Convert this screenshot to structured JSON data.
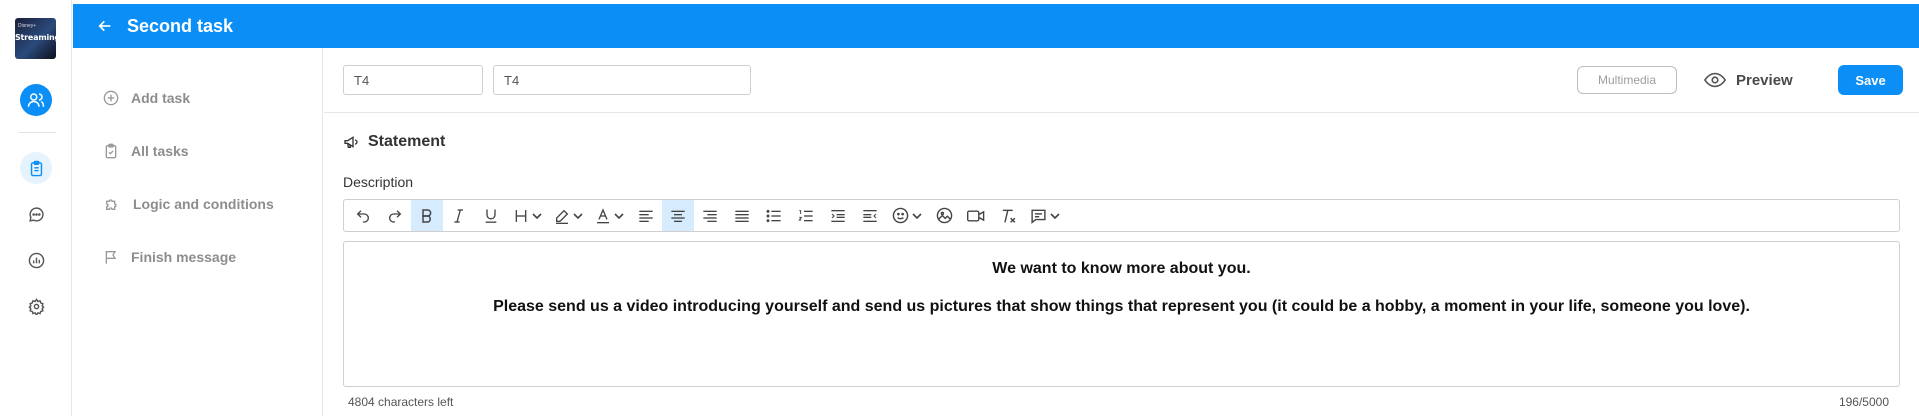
{
  "app": {
    "logo_text": "Streaming",
    "logo_sub": "Disney+"
  },
  "topbar": {
    "title": "Second task",
    "color": "#0b8ef6"
  },
  "rail": {
    "icons": [
      "users-icon",
      "clipboard-icon",
      "chat-icon",
      "chart-icon",
      "gear-icon"
    ]
  },
  "sidebar": {
    "items": [
      {
        "label": "Add task",
        "icon": "plus-circle-icon"
      },
      {
        "label": "All tasks",
        "icon": "clipboard-check-icon"
      },
      {
        "label": "Logic and conditions",
        "icon": "puzzle-icon"
      },
      {
        "label": "Finish message",
        "icon": "flag-icon"
      }
    ]
  },
  "header": {
    "code_value": "T4",
    "name_value": "T4",
    "multimedia_label": "Multimedia",
    "preview_label": "Preview",
    "save_label": "Save"
  },
  "statement": {
    "title": "Statement",
    "description_label": "Description",
    "line1": "We want to know more about you.",
    "line2": "Please send us a video introducing yourself and send us pictures that show things that represent you (it could be a hobby, a moment in your life, someone you love).",
    "chars_left": "4804 characters left",
    "char_count": "196/5000"
  },
  "toolbar": {
    "active": [
      "bold",
      "align-center"
    ]
  }
}
